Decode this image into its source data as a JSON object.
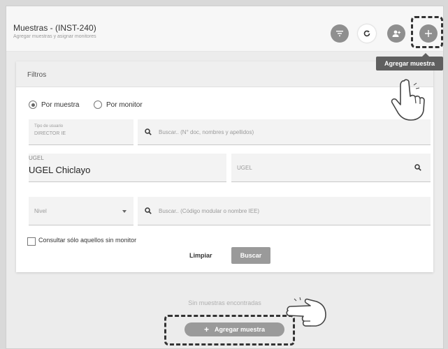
{
  "header": {
    "title": "Muestras - (INST-240)",
    "subtitle": "Agregar muestras y asignar monitores"
  },
  "tooltip": "Agregar muestra",
  "filters": {
    "title": "Filtros",
    "radio_sample": "Por muestra",
    "radio_monitor": "Por monitor",
    "tipo_label": "Tipo de usuario",
    "tipo_value": "DIRECTOR IE",
    "search_people_placeholder": "Buscar.. (N° doc, nombres y apellidos)",
    "ugel_label": "UGEL",
    "ugel_value": "UGEL Chiclayo",
    "ugel2_placeholder": "UGEL",
    "nivel_placeholder": "Nivel",
    "search_school_placeholder": "Buscar.. (Código modular o nombre IEE)",
    "check_label": "Consultar sólo aquellos sin monitor",
    "clear_label": "Limpiar",
    "search_label": "Buscar"
  },
  "empty_text": "Sin muestras encontradas",
  "add_button_label": "Agregar muestra",
  "colors": {
    "icon_gray": "#8f8f8f",
    "button_gray": "#9a9a9a",
    "tooltip_bg": "#5f5f5f"
  }
}
